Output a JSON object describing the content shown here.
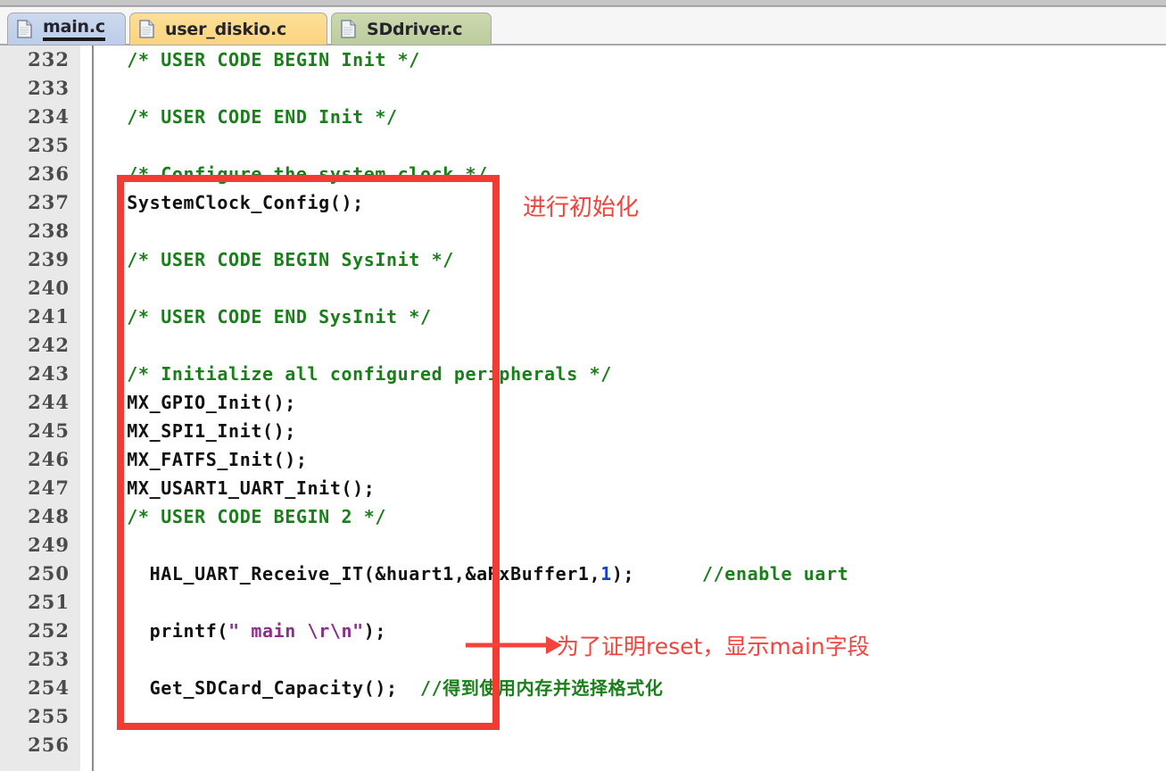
{
  "window": {
    "title": "main.c"
  },
  "tabs": [
    {
      "label": "main.c",
      "icon": "file-icon",
      "active": true,
      "color": "#c3d2ea"
    },
    {
      "label": "user_diskio.c",
      "icon": "file-icon",
      "active": false,
      "color": "#fcd98a"
    },
    {
      "label": "SDdriver.c",
      "icon": "file-icon",
      "active": false,
      "color": "#c3d1a3"
    }
  ],
  "editor": {
    "first_line": 232,
    "last_line": 256,
    "lines": [
      {
        "num": "232",
        "segments": [
          {
            "t": "  /* USER CODE BEGIN Init */",
            "c": "cm"
          }
        ]
      },
      {
        "num": "233",
        "segments": [
          {
            "t": "",
            "c": "pl"
          }
        ]
      },
      {
        "num": "234",
        "segments": [
          {
            "t": "  /* USER CODE END Init */",
            "c": "cm"
          }
        ]
      },
      {
        "num": "235",
        "segments": [
          {
            "t": "",
            "c": "pl"
          }
        ]
      },
      {
        "num": "236",
        "segments": [
          {
            "t": "  /* Configure the system clock */",
            "c": "cm"
          }
        ]
      },
      {
        "num": "237",
        "segments": [
          {
            "t": "  SystemClock_Config();",
            "c": "pl"
          }
        ]
      },
      {
        "num": "238",
        "segments": [
          {
            "t": "",
            "c": "pl"
          }
        ]
      },
      {
        "num": "239",
        "segments": [
          {
            "t": "  /* USER CODE BEGIN SysInit */",
            "c": "cm"
          }
        ]
      },
      {
        "num": "240",
        "segments": [
          {
            "t": "",
            "c": "pl"
          }
        ]
      },
      {
        "num": "241",
        "segments": [
          {
            "t": "  /* USER CODE END SysInit */",
            "c": "cm"
          }
        ]
      },
      {
        "num": "242",
        "segments": [
          {
            "t": "",
            "c": "pl"
          }
        ]
      },
      {
        "num": "243",
        "segments": [
          {
            "t": "  /* Initialize all configured peripherals */",
            "c": "cm"
          }
        ]
      },
      {
        "num": "244",
        "segments": [
          {
            "t": "  MX_GPIO_Init();",
            "c": "pl"
          }
        ]
      },
      {
        "num": "245",
        "segments": [
          {
            "t": "  MX_SPI1_Init();",
            "c": "pl"
          }
        ]
      },
      {
        "num": "246",
        "segments": [
          {
            "t": "  MX_FATFS_Init();",
            "c": "pl"
          }
        ]
      },
      {
        "num": "247",
        "segments": [
          {
            "t": "  MX_USART1_UART_Init();",
            "c": "pl"
          }
        ]
      },
      {
        "num": "248",
        "segments": [
          {
            "t": "  /* USER CODE BEGIN 2 */",
            "c": "cm"
          }
        ]
      },
      {
        "num": "249",
        "segments": [
          {
            "t": "",
            "c": "pl"
          }
        ]
      },
      {
        "num": "250",
        "segments": [
          {
            "t": "    HAL_UART_Receive_IT(&huart1,&aRxBuffer1,",
            "c": "pl"
          },
          {
            "t": "1",
            "c": "num"
          },
          {
            "t": ");      ",
            "c": "pl"
          },
          {
            "t": "//enable uart",
            "c": "cm"
          }
        ]
      },
      {
        "num": "251",
        "segments": [
          {
            "t": "",
            "c": "pl"
          }
        ]
      },
      {
        "num": "252",
        "segments": [
          {
            "t": "    printf(",
            "c": "pl"
          },
          {
            "t": "\" main \\r\\n\"",
            "c": "str"
          },
          {
            "t": ");",
            "c": "pl"
          }
        ]
      },
      {
        "num": "253",
        "segments": [
          {
            "t": "",
            "c": "pl"
          }
        ]
      },
      {
        "num": "254",
        "segments": [
          {
            "t": "    Get_SDCard_Capacity();  ",
            "c": "pl"
          },
          {
            "t": "//得到使用内存并选择格式化",
            "c": "cm"
          }
        ]
      },
      {
        "num": "255",
        "segments": [
          {
            "t": "",
            "c": "pl"
          }
        ]
      },
      {
        "num": "256",
        "segments": [
          {
            "t": "",
            "c": "pl"
          }
        ]
      }
    ]
  },
  "annotations": {
    "box_color": "#f23b33",
    "text_color": "#f4433c",
    "init_note": "进行初始化",
    "reset_note": "为了证明reset，显示main字段"
  },
  "colors": {
    "comment_green": "#1a7f1a",
    "string_purple": "#8b2f8b",
    "number_blue": "#1a3fd0",
    "gutter_gray": "#e9e9e9",
    "annotation_red": "#f23b33"
  }
}
